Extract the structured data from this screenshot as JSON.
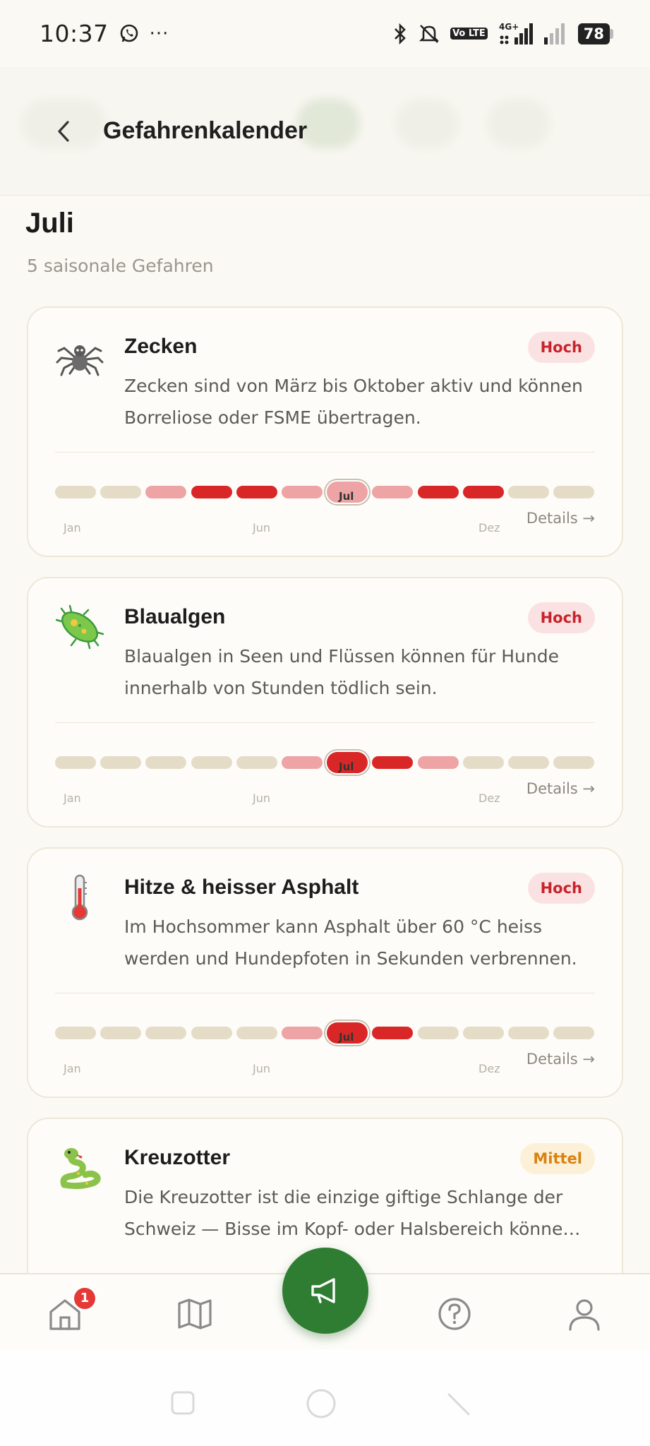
{
  "status_bar": {
    "time": "10:37",
    "more": "···",
    "volte": "Vo LTE",
    "network": "4G+",
    "battery": "78"
  },
  "header": {
    "title": "Gefahrenkalender"
  },
  "section": {
    "title": "Juli",
    "subtitle": "5 saisonale Gefahren"
  },
  "cards": [
    {
      "title": "Zecken",
      "icon": "spider-icon",
      "risk": "Hoch",
      "desc1": "Zecken sind von März bis Oktober aktiv und können",
      "desc2": "Borreliose oder FSME übertragen.",
      "months": [
        "inactive",
        "inactive",
        "low",
        "high",
        "high",
        "low",
        "low",
        "low",
        "high",
        "high",
        "inactive",
        "inactive"
      ],
      "current_label": "Jul",
      "tick_start": "Jan",
      "tick_mid": "Jun",
      "tick_end": "Dez",
      "details": "Details →"
    },
    {
      "title": "Blaualgen",
      "icon": "microbe-icon",
      "risk": "Hoch",
      "desc1": "Blaualgen in Seen und Flüssen können für Hunde",
      "desc2": "innerhalb von Stunden tödlich sein.",
      "months": [
        "inactive",
        "inactive",
        "inactive",
        "inactive",
        "inactive",
        "low",
        "high",
        "high",
        "low",
        "inactive",
        "inactive",
        "inactive"
      ],
      "current_label": "Jul",
      "tick_start": "Jan",
      "tick_mid": "Jun",
      "tick_end": "Dez",
      "details": "Details →"
    },
    {
      "title": "Hitze & heisser Asphalt",
      "icon": "thermometer-icon",
      "risk": "Hoch",
      "desc1": "Im Hochsommer kann Asphalt über 60 °C heiss",
      "desc2": "werden und Hundepfoten in Sekunden verbrennen.",
      "months": [
        "inactive",
        "inactive",
        "inactive",
        "inactive",
        "inactive",
        "low",
        "high",
        "high",
        "inactive",
        "inactive",
        "inactive",
        "inactive"
      ],
      "current_label": "Jul",
      "tick_start": "Jan",
      "tick_mid": "Jun",
      "tick_end": "Dez",
      "details": "Details →"
    },
    {
      "title": "Kreuzotter",
      "icon": "snake-icon",
      "risk": "Mittel",
      "desc1": "Die Kreuzotter ist die einzige giftige Schlange der",
      "desc2": "Schweiz — Bisse im Kopf- oder Halsbereich könne…"
    }
  ],
  "bottom_nav": {
    "home_badge": "1",
    "items": [
      "home-icon",
      "map-icon",
      "megaphone-icon",
      "help-icon",
      "profile-icon"
    ]
  },
  "colors": {
    "accent_green": "#2f7d32",
    "risk_high": "#d92727",
    "risk_low": "#eea4a4",
    "inactive": "#e5dcc8",
    "badge_hoch_bg": "#fbe2e2",
    "badge_mittel_bg": "#fdf0d8"
  }
}
